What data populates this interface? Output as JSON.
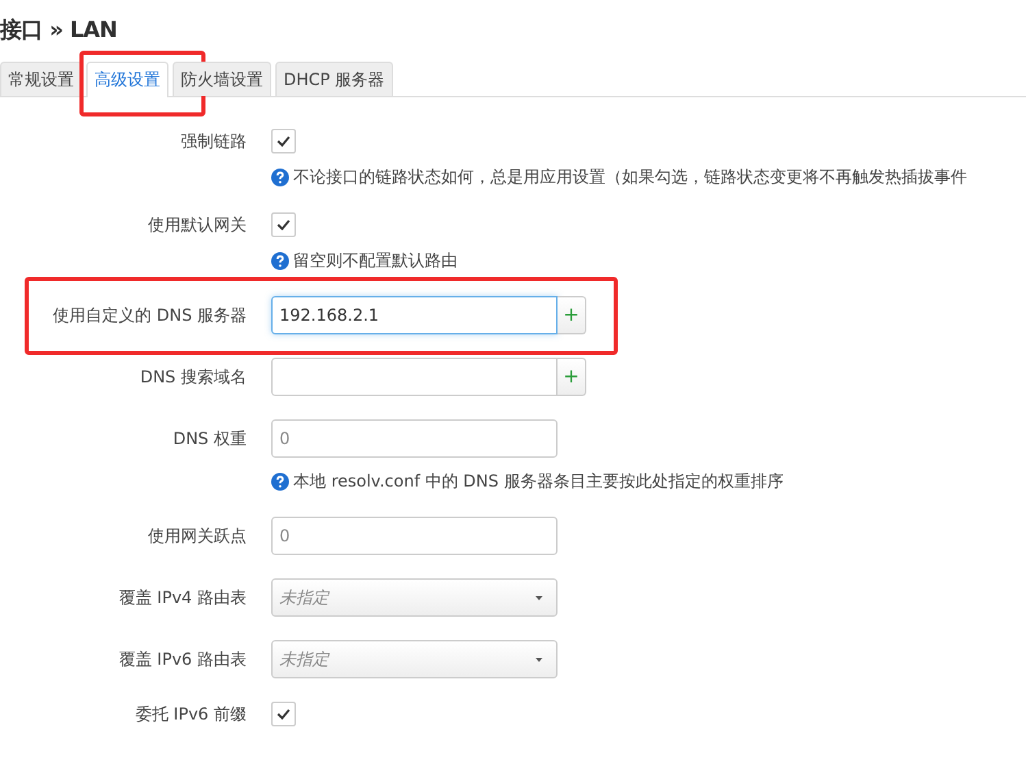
{
  "title": "接口 » LAN",
  "tabs": [
    {
      "label": "常规设置",
      "selected": false,
      "highlighted": false
    },
    {
      "label": "高级设置",
      "selected": true,
      "highlighted": true
    },
    {
      "label": "防火墙设置",
      "selected": false,
      "highlighted": false
    },
    {
      "label": "DHCP 服务器",
      "selected": false,
      "highlighted": false
    }
  ],
  "rows": [
    {
      "kind": "checkbox",
      "label": "强制链路",
      "checked": true,
      "help": "不论接口的链路状态如何，总是用应用设置（如果勾选，链路状态变更将不再触发热插拔事件",
      "highlighted": false
    },
    {
      "kind": "checkbox",
      "label": "使用默认网关",
      "checked": true,
      "help": "留空则不配置默认路由",
      "highlighted": false
    },
    {
      "kind": "list",
      "label": "使用自定义的 DNS 服务器",
      "value": "192.168.2.1",
      "focused": true,
      "add": "+",
      "highlighted": true
    },
    {
      "kind": "list",
      "label": "DNS 搜索域名",
      "focused": false,
      "add": "+",
      "highlighted": false
    },
    {
      "kind": "text",
      "label": "DNS 权重",
      "placeholder": "0",
      "help": "本地 resolv.conf 中的 DNS 服务器条目主要按此处指定的权重排序",
      "highlighted": false
    },
    {
      "kind": "text",
      "label": "使用网关跃点",
      "placeholder": "0",
      "highlighted": false
    },
    {
      "kind": "select",
      "label": "覆盖 IPv4 路由表",
      "value": "未指定",
      "highlighted": false
    },
    {
      "kind": "select",
      "label": "覆盖 IPv6 路由表",
      "value": "未指定",
      "highlighted": false
    },
    {
      "kind": "checkbox",
      "label": "委托 IPv6 前缀",
      "checked": true,
      "highlighted": false
    }
  ]
}
